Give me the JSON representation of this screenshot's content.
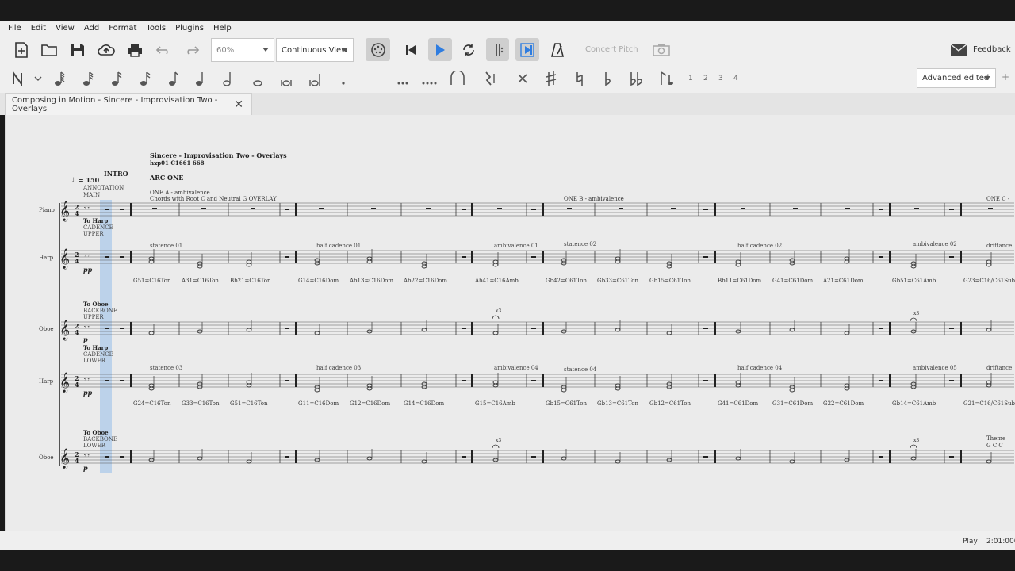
{
  "menu": [
    "File",
    "Edit",
    "View",
    "Add",
    "Format",
    "Tools",
    "Plugins",
    "Help"
  ],
  "toolbar": {
    "zoom_value": "60%",
    "view_mode": "Continuous View",
    "concert_pitch": "Concert Pitch",
    "feedback": "Feedback"
  },
  "note_input": {
    "voices": [
      "1",
      "2",
      "3",
      "4"
    ],
    "workspace": "Advanced edited"
  },
  "tab": {
    "title": "Composing in Motion - Sincere - Improvisation Two - Overlays"
  },
  "score": {
    "title": "Sincere - Improvisation Two - Overlays",
    "subtitle": "hxp01 C1661 668",
    "tempo": "= 150",
    "rehearsal_intro": "INTRO",
    "arc": "ARC ONE",
    "annotation1": "ANNOTATION",
    "annotation2": "MAIN",
    "section_a": "ONE A - ambivalence",
    "section_a_sub": "Chords with Root C and Neutral G OVERLAY",
    "section_b": "ONE B - ambivalence",
    "section_c": "ONE C -",
    "instruments": [
      "Piano",
      "Harp",
      "Oboe",
      "Harp",
      "Oboe"
    ],
    "harp1_label": [
      "To Harp",
      "CADENCE",
      "UPPER"
    ],
    "oboe1_label": [
      "To Oboe",
      "BACKBONE",
      "UPPER"
    ],
    "harp2_label": [
      "To Harp",
      "CADENCE",
      "LOWER"
    ],
    "oboe2_label": [
      "To Oboe",
      "BACKBONE",
      "LOWER"
    ],
    "dyn_pp": "pp",
    "dyn_p": "p",
    "harp1_marks": [
      "statence 01",
      "half cadence 01",
      "ambivalence 01",
      "statence 02",
      "half cadence 02",
      "ambivalence 02",
      "driftance"
    ],
    "harp2_marks": [
      "statence 03",
      "half cadence 03",
      "ambivalence 04",
      "statence 04",
      "half cadence 04",
      "ambivalence 05",
      "driftance"
    ],
    "harp1_chords": [
      "G51=C16Ton",
      "A31=C16Ton",
      "Bb21=C16Ton",
      "G14=C16Dom",
      "Ab13=C16Dom",
      "Ab22=C16Dom",
      "Ab41=C16Amb",
      "Gb42=C61Ton",
      "Gb33=C61Ton",
      "Gb15=C61Ton",
      "Bb11=C61Dom",
      "G41=C61Dom",
      "A21=C61Dom",
      "Gb51=C61Amb",
      "G23=C16/C61Sub"
    ],
    "harp2_chords": [
      "G24=C16Ton",
      "G33=C16Ton",
      "G51=C16Ton",
      "G11=C16Dom",
      "G12=C16Dom",
      "G14=C16Dom",
      "G15=C16Amb",
      "Gb15=C61Ton",
      "Gb13=C61Ton",
      "Gb12=C61Ton",
      "G41=C61Dom",
      "G31=C61Dom",
      "G22=C61Dom",
      "Gb14=C61Amb",
      "G21=C16/C61Sub"
    ],
    "repeat_mark": "x3",
    "theme_label": "Theme",
    "theme_sub": "G C C"
  },
  "status": {
    "mode": "Play",
    "time": "2:01:000"
  }
}
